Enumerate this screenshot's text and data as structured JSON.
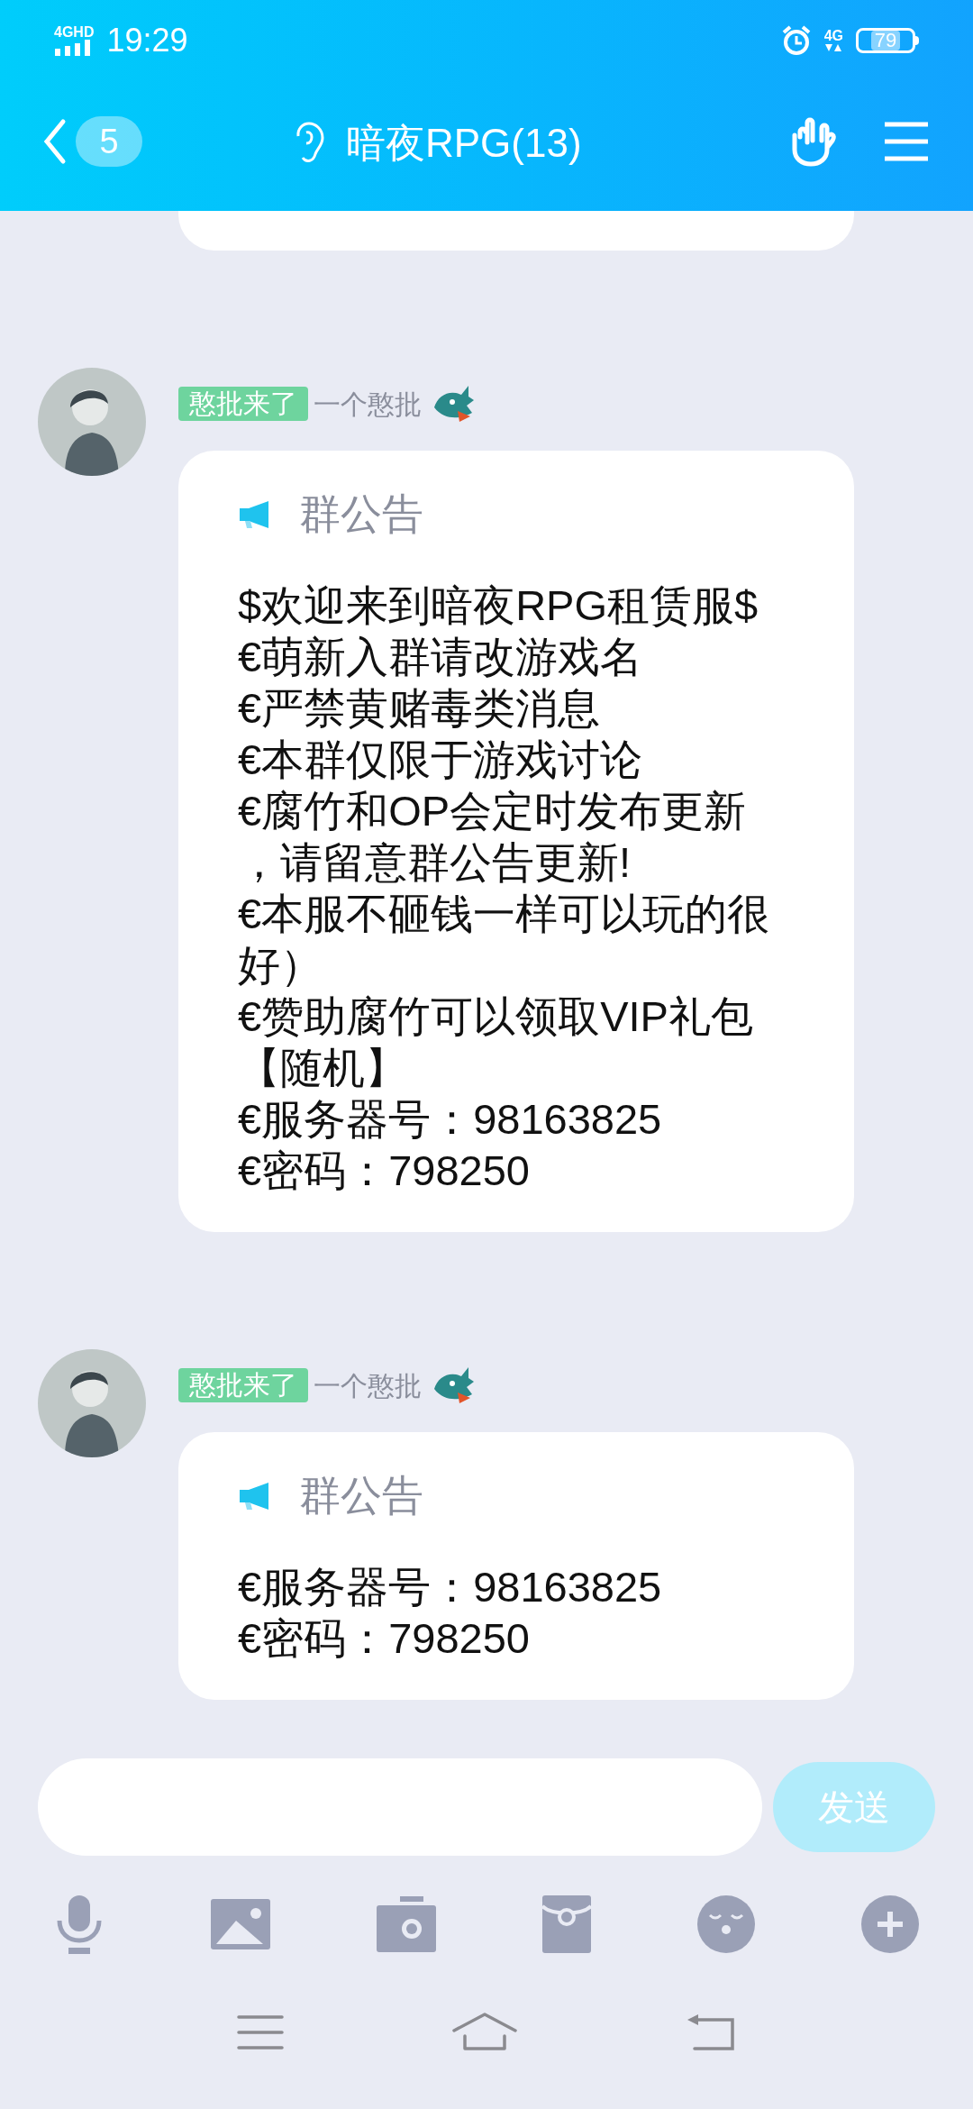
{
  "status_bar": {
    "network": "4GHD",
    "time": "19:29",
    "data": "4G",
    "battery": "79"
  },
  "header": {
    "unread": "5",
    "title": "暗夜RPG(13)"
  },
  "messages": [
    {
      "tag": "憨批来了",
      "sender": "一个憨批",
      "card_title": "群公告",
      "lines": [
        "$欢迎来到暗夜RPG租赁服$",
        "€萌新入群请改游戏名",
        "€严禁黄赌毒类消息",
        "€本群仅限于游戏讨论",
        "€腐竹和OP会定时发布更新",
        "，请留意群公告更新!",
        "€本服不砸钱一样可以玩的很",
        "好）",
        "€赞助腐竹可以领取VIP礼包",
        "【随机】",
        "€服务器号：98163825",
        "€密码：798250"
      ]
    },
    {
      "tag": "憨批来了",
      "sender": "一个憨批",
      "card_title": "群公告",
      "lines": [
        "€服务器号：98163825",
        "€密码：798250"
      ]
    }
  ],
  "composer": {
    "send": "发送"
  }
}
